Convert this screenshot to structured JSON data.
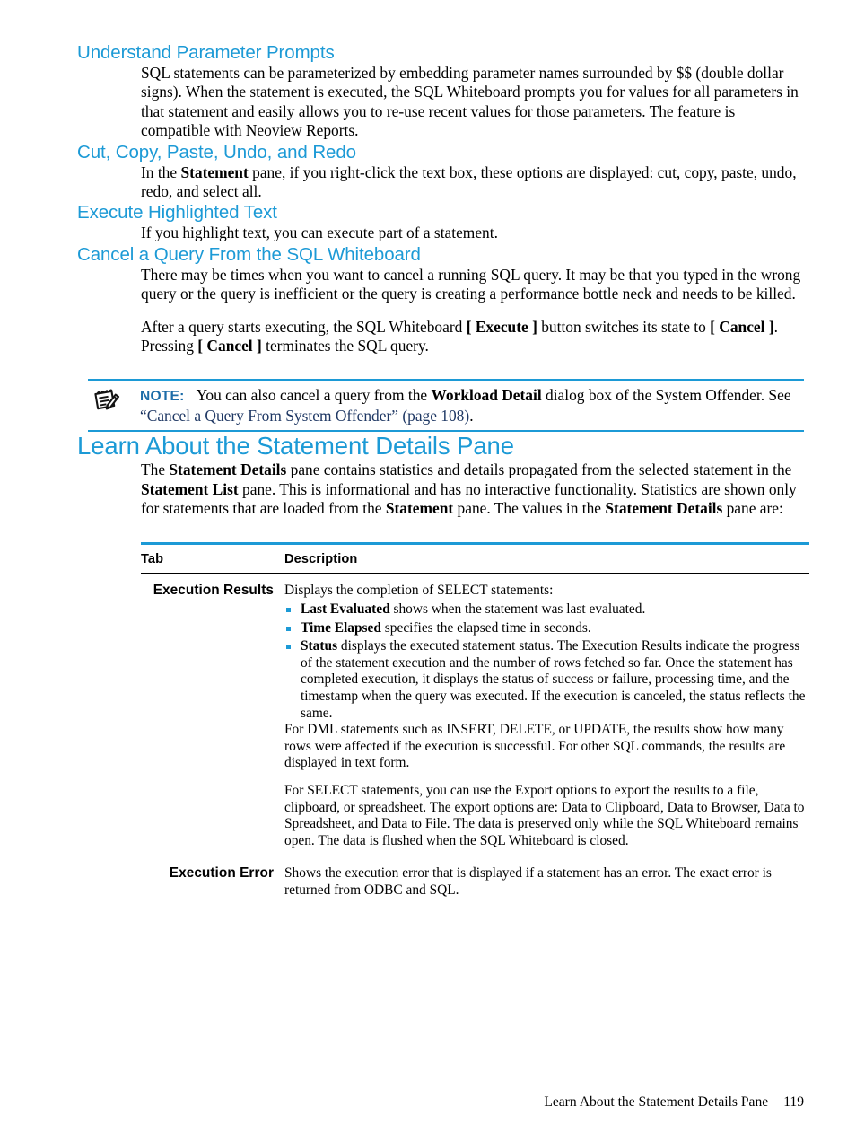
{
  "document": {
    "sections": [
      {
        "id": "understand-parameter-prompts",
        "level": 3,
        "title": "Understand Parameter Prompts",
        "paragraphs": [
          "SQL statements can be parameterized by embedding parameter names surrounded by $$ (double dollar signs). When the statement is executed, the SQL Whiteboard prompts you for values for all parameters in that statement and easily allows you to re-use recent values for those parameters. The feature is compatible with Neoview Reports."
        ]
      },
      {
        "id": "cut-copy-paste-undo-redo",
        "level": 3,
        "title": "Cut, Copy, Paste, Undo, and Redo",
        "paragraph_parts": [
          {
            "t": "In the ",
            "b": false
          },
          {
            "t": "Statement",
            "b": true
          },
          {
            "t": " pane, if you right-click the text box, these options are displayed: cut, copy, paste, undo, redo, and select all.",
            "b": false
          }
        ]
      },
      {
        "id": "execute-highlighted-text",
        "level": 3,
        "title": "Execute Highlighted Text",
        "paragraphs": [
          "If you highlight text, you can execute part of a statement."
        ]
      },
      {
        "id": "cancel-a-query-from-the-sql-whiteboard",
        "level": 3,
        "title": "Cancel a Query From the SQL Whiteboard",
        "paragraphs": [
          "There may be times when you want to cancel a running SQL query. It may be that you typed in the wrong query or the query is inefficient or the query is creating a performance bottle neck and needs to be killed."
        ],
        "paragraph2_parts": [
          {
            "t": "After a query starts executing, the SQL Whiteboard ",
            "b": false
          },
          {
            "t": "[ Execute ]",
            "b": true
          },
          {
            "t": " button switches its state to ",
            "b": false
          },
          {
            "t": "[ Cancel ]",
            "b": true
          },
          {
            "t": ". Pressing ",
            "b": false
          },
          {
            "t": "[ Cancel ]",
            "b": true
          },
          {
            "t": " terminates the SQL query.",
            "b": false
          }
        ]
      }
    ],
    "note": {
      "icon": "note-pad-pencil-icon",
      "label": "NOTE:",
      "text_parts": [
        {
          "t": "You can also cancel a query from the ",
          "b": false,
          "link": false
        },
        {
          "t": "Workload Detail",
          "b": true,
          "link": false
        },
        {
          "t": " dialog box of the System Offender. See ",
          "b": false,
          "link": false
        },
        {
          "t": "“Cancel a Query From System Offender” (page 108)",
          "b": false,
          "link": true
        },
        {
          "t": ".",
          "b": false,
          "link": false
        }
      ]
    },
    "main_section": {
      "id": "learn-about-the-statement-details-pane",
      "level": 2,
      "title": "Learn About the Statement Details Pane",
      "intro_parts": [
        {
          "t": "The ",
          "b": false
        },
        {
          "t": "Statement Details",
          "b": true
        },
        {
          "t": " pane contains statistics and details propagated from the selected statement in the ",
          "b": false
        },
        {
          "t": "Statement List",
          "b": true
        },
        {
          "t": " pane. This is informational and has no interactive functionality. Statistics are shown only for statements that are loaded from the ",
          "b": false
        },
        {
          "t": "Statement",
          "b": true
        },
        {
          "t": " pane. The values in the ",
          "b": false
        },
        {
          "t": "Statement Details",
          "b": true
        },
        {
          "t": " pane are:",
          "b": false
        }
      ]
    },
    "table": {
      "headers": [
        "Tab",
        "Description"
      ],
      "rows": [
        {
          "tab": "Execution Results",
          "lead": "Displays the completion of SELECT statements:",
          "bullets": [
            [
              {
                "t": "Last Evaluated",
                "b": true
              },
              {
                "t": " shows when the statement was last evaluated.",
                "b": false
              }
            ],
            [
              {
                "t": "Time Elapsed",
                "b": true
              },
              {
                "t": " specifies the elapsed time in seconds.",
                "b": false
              }
            ],
            [
              {
                "t": "Status",
                "b": true
              },
              {
                "t": "  displays the executed statement status. The Execution Results indicate the progress of the statement execution and the number of rows fetched so far. Once the statement has completed execution, it displays the status of success or failure, processing time, and the timestamp when the query was executed. If the execution is canceled, the status reflects the same.",
                "b": false
              }
            ]
          ],
          "paragraphs": [
            "For DML statements such as INSERT, DELETE, or UPDATE, the results show how many rows were affected if the execution is successful. For other SQL commands, the results are displayed in text form.",
            "For SELECT statements, you can use the Export options to export the results to a file, clipboard, or spreadsheet. The export options are: Data to Clipboard, Data to Browser, Data to Spreadsheet, and Data to File. The data is preserved only while the SQL Whiteboard remains open. The data is flushed when the SQL Whiteboard is closed."
          ]
        },
        {
          "tab": "Execution Error",
          "lead": "",
          "bullets": [],
          "paragraphs": [
            "Shows the execution error that is displayed if a statement has an error. The exact error is returned from ODBC and SQL."
          ]
        }
      ]
    },
    "footer": {
      "running_head": "Learn About the Statement Details Pane",
      "page_number": "119"
    },
    "colors": {
      "heading_blue": "#1c9ad6",
      "note_label_blue": "#1c6ca8",
      "link_navy": "#1f3864",
      "rule_blue": "#1c9ad6",
      "bullet_blue": "#1c9ad6"
    }
  }
}
